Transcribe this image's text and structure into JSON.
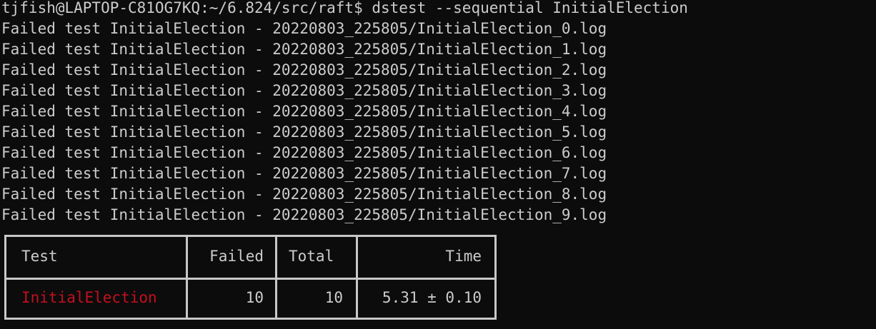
{
  "terminal": {
    "prompt_line": "tjfish@LAPTOP-C81OG7KQ:~/6.824/src/raft$ dstest --sequential InitialElection",
    "output_lines": [
      "Failed test InitialElection - 20220803_225805/InitialElection_0.log",
      "Failed test InitialElection - 20220803_225805/InitialElection_1.log",
      "Failed test InitialElection - 20220803_225805/InitialElection_2.log",
      "Failed test InitialElection - 20220803_225805/InitialElection_3.log",
      "Failed test InitialElection - 20220803_225805/InitialElection_4.log",
      "Failed test InitialElection - 20220803_225805/InitialElection_5.log",
      "Failed test InitialElection - 20220803_225805/InitialElection_6.log",
      "Failed test InitialElection - 20220803_225805/InitialElection_7.log",
      "Failed test InitialElection - 20220803_225805/InitialElection_8.log",
      "Failed test InitialElection - 20220803_225805/InitialElection_9.log"
    ]
  },
  "table": {
    "headers": {
      "test": "Test",
      "failed": "Failed",
      "total": "Total",
      "time": "Time"
    },
    "row": {
      "test": "InitialElection",
      "failed": "10",
      "total": "10",
      "time": "5.31 ± 0.10"
    }
  },
  "colors": {
    "background": "#0c0c0c",
    "foreground": "#cccccc",
    "failed_test_name": "#c50f1f",
    "table_border": "#c8c8c8"
  }
}
